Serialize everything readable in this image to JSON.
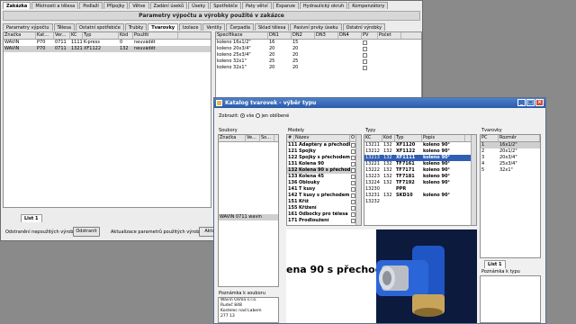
{
  "main_window": {
    "top_tabs": [
      "Zakázka",
      "Místnosti a tělesa",
      "Podlaží",
      "Přípojky",
      "Větve",
      "Zadání úseků",
      "Úseky",
      "Spotřebiče",
      "Paty větví",
      "Expanze",
      "Hydraulický okruh",
      "Kompenzátory"
    ],
    "panel_title": "Parametry výpočtu a výrobky použité v zakázce",
    "sub_tabs": [
      "Parametry výpočtu",
      "Tělesa",
      "Ostatní spotřebiče",
      "Trubky",
      "Tvarovky",
      "Izolace",
      "Ventily",
      "Čerpadla",
      "Sklad tělesa",
      "Pasivní prvky úseku",
      "Ostatní výrobky"
    ],
    "left_table": {
      "columns": [
        "Značka",
        "Kat...",
        "Ver...",
        "KC",
        "Typ",
        "Kód",
        "Použití"
      ],
      "rows": [
        [
          "WAVIN",
          "P70",
          "0711",
          "11110",
          "K-press",
          "0",
          "neuvádět"
        ],
        [
          "WAVIN",
          "P70",
          "0711",
          "13212",
          "XF1122",
          "132",
          "neuvádět"
        ]
      ]
    },
    "right_table": {
      "columns": [
        "Specifikace",
        "DN1",
        "DN2",
        "DN3",
        "DN4",
        "PV",
        "Počet"
      ],
      "rows": [
        [
          "koleno 16x1/2\"",
          "16",
          "15",
          "",
          "",
          "",
          ""
        ],
        [
          "koleno 20x3/4\"",
          "20",
          "20",
          "",
          "",
          "",
          ""
        ],
        [
          "koleno 25x3/4\"",
          "20",
          "20",
          "",
          "",
          "",
          ""
        ],
        [
          "koleno 32x1\"",
          "25",
          "25",
          "",
          "",
          "",
          ""
        ],
        [
          "koleno 32x1\"",
          "20",
          "20",
          "",
          "",
          "",
          ""
        ]
      ]
    },
    "list_tab": "List 1",
    "remove_unused_label": "Odstranění nepoužitých výrobků",
    "remove_button": "Odstranit",
    "update_label": "Aktualizace parametrů použitých výrobků",
    "update_button": "Aktuali"
  },
  "catalog": {
    "title": "Katalog tvarovek - výběr typu",
    "show_label": "Zobrazit:",
    "radio_all": "vše",
    "radio_fav": "jen oblíbené",
    "sources": {
      "title": "Soubory",
      "columns": [
        "Značka",
        "Ve...",
        "So..."
      ],
      "selected": "WAVIN   0711  wavin"
    },
    "models": {
      "title": "Modely",
      "columns": [
        "#",
        "Název",
        "O"
      ],
      "rows": [
        {
          "id": "111",
          "name": "Adaptéry a přechodky"
        },
        {
          "id": "121",
          "name": "Spojky"
        },
        {
          "id": "122",
          "name": "Spojky s přechodem"
        },
        {
          "id": "131",
          "name": "Kolena 90"
        },
        {
          "id": "132",
          "name": "Kolena 90 s přechodem"
        },
        {
          "id": "133",
          "name": "Kolena 45"
        },
        {
          "id": "136",
          "name": "Oblouky"
        },
        {
          "id": "141",
          "name": "T kusy"
        },
        {
          "id": "142",
          "name": "T kusy s přechodem"
        },
        {
          "id": "151",
          "name": "Kříž"
        },
        {
          "id": "155",
          "name": "Křížení"
        },
        {
          "id": "161",
          "name": "Odbočky pro tělesa"
        },
        {
          "id": "171",
          "name": "Prodloužení"
        }
      ]
    },
    "types": {
      "title": "Typy",
      "columns": [
        "KC",
        "Kód",
        "Typ",
        "Popis"
      ],
      "rows": [
        [
          "13211",
          "132",
          "XF1120",
          "koleno 90°"
        ],
        [
          "13212",
          "132",
          "XF1122",
          "koleno 90°"
        ],
        [
          "13213",
          "132",
          "XF1111",
          "koleno 90°"
        ],
        [
          "13221",
          "132",
          "TF7161",
          "koleno 90°"
        ],
        [
          "13222",
          "132",
          "TF7171",
          "koleno 90°"
        ],
        [
          "13223",
          "132",
          "TF7181",
          "koleno 90°"
        ],
        [
          "13224",
          "132",
          "TF7192",
          "koleno 90°"
        ],
        [
          "13230",
          "",
          "PPR",
          ""
        ],
        [
          "13231",
          "132",
          "SKD10",
          "koleno 90°"
        ],
        [
          "13232",
          "",
          "",
          ""
        ]
      ]
    },
    "fittings": {
      "title": "Tvarovky",
      "columns": [
        "PC",
        "Rozměr"
      ],
      "rows": [
        [
          "1",
          "16x1/2\""
        ],
        [
          "2",
          "20x1/2\""
        ],
        [
          "3",
          "20x3/4\""
        ],
        [
          "4",
          "25x3/4\""
        ],
        [
          "5",
          "32x1\""
        ]
      ]
    },
    "list_tab": "List 1",
    "big_text": "ena 90 s přechod",
    "note_fitting": "Poznámka k typu",
    "note_source_title": "Poznámka k souboru",
    "note_source_lines": [
      "Wavin Osma s.r.o.",
      "Rudeč 848",
      "Kostelec nad Labem",
      "277 13"
    ]
  }
}
